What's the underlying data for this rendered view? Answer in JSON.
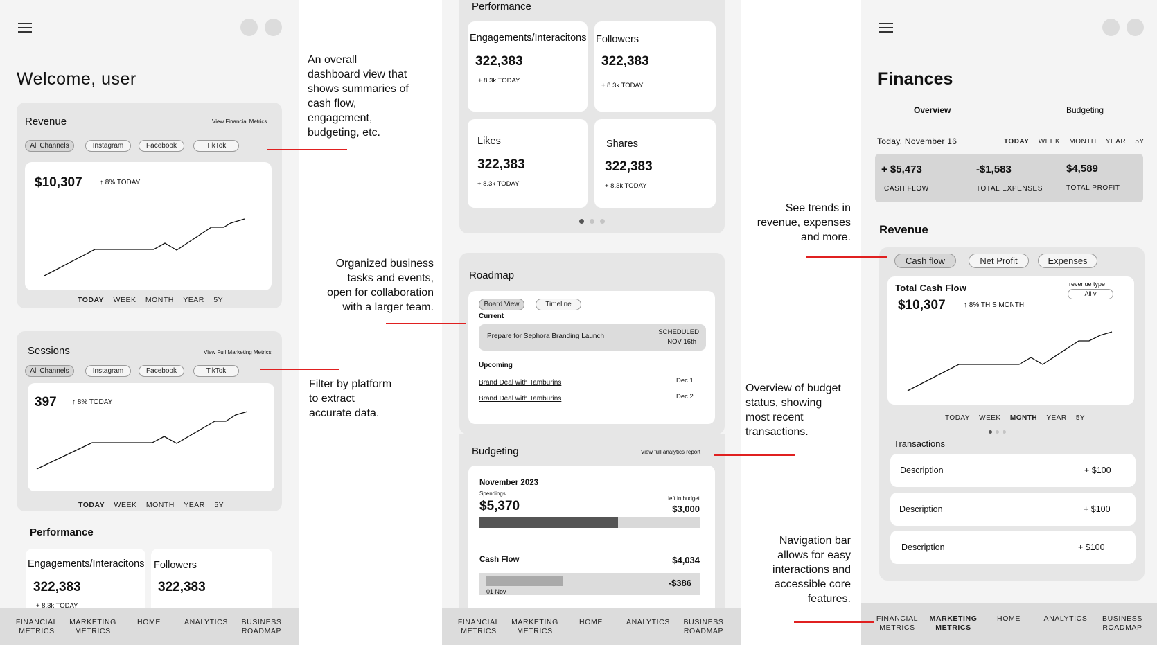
{
  "dashboard": {
    "title": "Welcome, user",
    "revenue": {
      "heading": "Revenue",
      "link": "View Financial Metrics",
      "filters": [
        "All Channels",
        "Instagram",
        "Facebook",
        "TikTok"
      ],
      "value": "$10,307",
      "change": "8% TODAY",
      "ranges": [
        "TODAY",
        "WEEK",
        "MONTH",
        "YEAR",
        "5Y"
      ],
      "active_range": "TODAY"
    },
    "sessions": {
      "heading": "Sessions",
      "link": "View Full Marketing Metrics",
      "filters": [
        "All Channels",
        "Instagram",
        "Facebook",
        "TikTok"
      ],
      "value": "397",
      "change": "8% TODAY",
      "ranges": [
        "TODAY",
        "WEEK",
        "MONTH",
        "YEAR",
        "5Y"
      ]
    },
    "performance": {
      "heading": "Performance",
      "tiles": [
        {
          "label": "Engagements/Interacitons",
          "value": "322,383",
          "sub": "+ 8.3k TODAY"
        },
        {
          "label": "Followers",
          "value": "322,383"
        }
      ]
    }
  },
  "marketing": {
    "performance": {
      "heading": "Performance",
      "tiles": [
        {
          "label": "Engagements/Interacitons",
          "value": "322,383",
          "sub": "+ 8.3k TODAY"
        },
        {
          "label": "Followers",
          "value": "322,383",
          "sub": "+ 8.3k TODAY"
        },
        {
          "label": "Likes",
          "value": "322,383",
          "sub": "+ 8.3k TODAY"
        },
        {
          "label": "Shares",
          "value": "322,383",
          "sub": "+ 8.3k TODAY"
        }
      ]
    },
    "roadmap": {
      "heading": "Roadmap",
      "views": [
        "Board View",
        "Timeline"
      ],
      "current_label": "Current",
      "current_task": "Prepare for Sephora Branding Launch",
      "current_status": "SCHEDULED",
      "current_date": "NOV 16th",
      "upcoming_label": "Upcoming",
      "upcoming": [
        {
          "name": "Brand Deal with Tamburins",
          "date": "Dec 1"
        },
        {
          "name": "Brand Deal with Tamburins",
          "date": "Dec 2"
        }
      ]
    },
    "budgeting": {
      "heading": "Budgeting",
      "link": "View full analytics report",
      "month": "November 2023",
      "spend_label": "Spendings",
      "spend_value": "$5,370",
      "left_label": "left in budget",
      "left_value": "$3,000",
      "spent_fraction": 0.63,
      "cashflow_label": "Cash Flow",
      "cashflow_value": "$4,034",
      "row_value": "-$386",
      "row_date": "01 Nov"
    }
  },
  "finances": {
    "title": "Finances",
    "tabs": [
      "Overview",
      "Budgeting"
    ],
    "date": "Today, November 16",
    "ranges": [
      "TODAY",
      "WEEK",
      "MONTH",
      "YEAR",
      "5Y"
    ],
    "summary": [
      {
        "value": "+ $5,473",
        "label": "CASH FLOW"
      },
      {
        "value": "-$1,583",
        "label": "TOTAL EXPENSES"
      },
      {
        "value": "$4,589",
        "label": "TOTAL PROFIT"
      }
    ],
    "revenue_heading": "Revenue",
    "chips": [
      "Cash flow",
      "Net Profit",
      "Expenses"
    ],
    "chart_title": "Total Cash Flow",
    "revenue_type_label": "revenue type",
    "revenue_type_value": "All v",
    "chart_value": "$10,307",
    "chart_change": "8% THIS MONTH",
    "chart_ranges": [
      "TODAY",
      "WEEK",
      "MONTH",
      "YEAR",
      "5Y"
    ],
    "transactions_heading": "Transactions",
    "transactions": [
      {
        "description": "Description",
        "amount": "+ $100"
      },
      {
        "description": "Description",
        "amount": "+ $100"
      },
      {
        "description": "Description",
        "amount": "+ $100"
      }
    ]
  },
  "nav": {
    "items": [
      [
        "FINANCIAL",
        "METRICS"
      ],
      [
        "MARKETING",
        "METRICS"
      ],
      [
        "HOME",
        ""
      ],
      [
        "ANALYTICS",
        ""
      ],
      [
        "BUSINESS",
        "ROADMAP"
      ]
    ]
  },
  "annotations": {
    "a1": [
      "An overall",
      "dashboard view that",
      "shows summaries of",
      "cash flow,",
      "engagement,",
      "budgeting, etc."
    ],
    "a2": [
      "Organized business",
      "tasks and events,",
      "open for collaboration",
      "with a larger team."
    ],
    "a3": [
      "Filter by platform",
      "to extract",
      "accurate data."
    ],
    "a4": [
      "See trends in",
      "revenue, expenses",
      "and more."
    ],
    "a5": [
      "Overview of budget",
      "status, showing",
      "most recent",
      "transactions."
    ],
    "a6": [
      "Navigation bar",
      "allows for easy",
      "interactions and",
      "accessible core",
      "features."
    ]
  }
}
